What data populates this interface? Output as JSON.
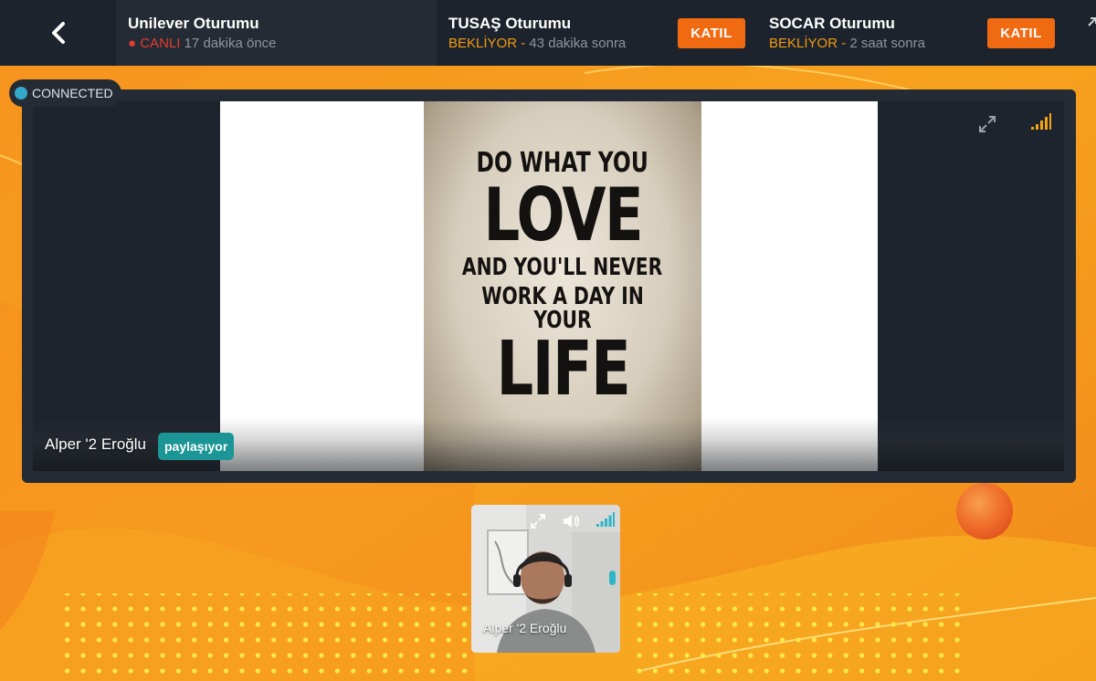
{
  "sessions": [
    {
      "title": "Unilever Oturumu",
      "status_label": "● CANLI",
      "status_time": "17 dakika önce",
      "status_kind": "live"
    },
    {
      "title": "TUSAŞ Oturumu",
      "status_label": "BEKLİYOR -",
      "status_time": "43 dakika sonra",
      "status_kind": "waiting",
      "join_label": "KATIL"
    },
    {
      "title": "SOCAR Oturumu",
      "status_label": "BEKLİYOR -",
      "status_time": "2 saat sonra",
      "status_kind": "waiting",
      "join_label": "KATIL"
    }
  ],
  "connection": {
    "label": "CONNECTED"
  },
  "stage": {
    "presenter_name": "Alper '2 Eroğlu",
    "share_badge": "paylaşıyor",
    "poster_lines": [
      "DO WHAT YOU",
      "LOVE",
      "AND YOU'LL NEVER",
      "WORK A DAY IN YOUR",
      "LIFE"
    ]
  },
  "participant": {
    "name": "Alper '2 Eroğlu"
  },
  "icons": {
    "back": "chevron-left-icon",
    "expand": "expand-icon",
    "signal": "signal-bars-icon",
    "volume": "volume-icon"
  },
  "colors": {
    "topbar": "#1d232c",
    "active_session": "#252b35",
    "live": "#e43b30",
    "waiting": "#f29a12",
    "join_button": "#f06a12",
    "connected_dot": "#33a8c9",
    "share_badge": "#1b9595",
    "background": "#f59a1c"
  }
}
